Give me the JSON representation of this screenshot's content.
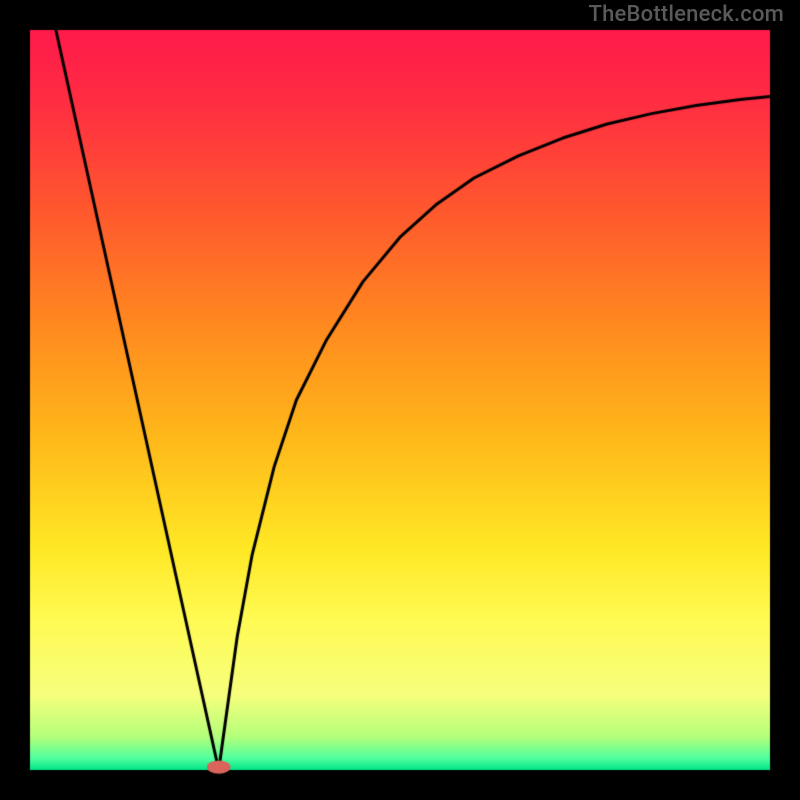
{
  "watermark": "TheBottleneck.com",
  "chart_data": {
    "type": "line",
    "title": "",
    "xlabel": "",
    "ylabel": "",
    "xlim": [
      0,
      100
    ],
    "ylim": [
      0,
      100
    ],
    "grid": false,
    "background_gradient": {
      "stops": [
        {
          "pos": 0.0,
          "color": "#ff1a4b"
        },
        {
          "pos": 0.1,
          "color": "#ff2e42"
        },
        {
          "pos": 0.25,
          "color": "#ff5a2d"
        },
        {
          "pos": 0.4,
          "color": "#ff8a1f"
        },
        {
          "pos": 0.55,
          "color": "#ffb81a"
        },
        {
          "pos": 0.7,
          "color": "#ffe825"
        },
        {
          "pos": 0.8,
          "color": "#fffb55"
        },
        {
          "pos": 0.9,
          "color": "#f6ff7d"
        },
        {
          "pos": 0.955,
          "color": "#b4ff7a"
        },
        {
          "pos": 0.985,
          "color": "#4dffa0"
        },
        {
          "pos": 1.0,
          "color": "#00e586"
        }
      ]
    },
    "series": [
      {
        "name": "left",
        "x": [
          3.5,
          25.5
        ],
        "y": [
          100,
          0
        ],
        "style": "line",
        "color": "#000000"
      },
      {
        "name": "right",
        "x": [
          25.5,
          28,
          30,
          33,
          36,
          40,
          45,
          50,
          55,
          60,
          66,
          72,
          78,
          84,
          90,
          96,
          100
        ],
        "y": [
          0,
          18,
          29,
          41,
          50,
          58,
          66,
          72,
          76.5,
          80,
          83,
          85.4,
          87.3,
          88.7,
          89.8,
          90.6,
          91
        ],
        "style": "line",
        "color": "#000000"
      }
    ],
    "marker": {
      "x": 25.5,
      "y": 0.4,
      "rx": 1.6,
      "ry": 0.9,
      "color": "#d9655a"
    },
    "frame": {
      "border_color": "#000000",
      "border_px": 30
    }
  }
}
